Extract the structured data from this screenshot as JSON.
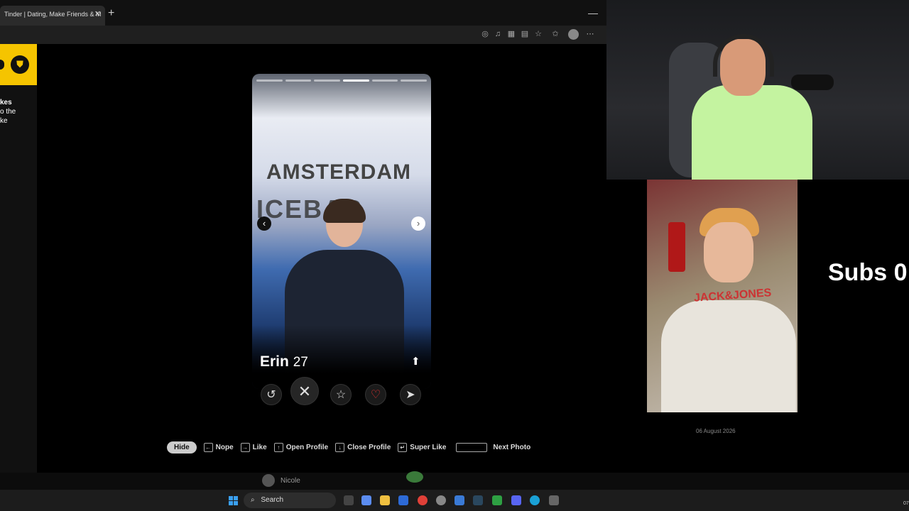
{
  "browser": {
    "tab_title": "Tinder | Dating, Make Friends & M",
    "tab_close": "✕",
    "new_tab": "+",
    "minimize": "—"
  },
  "left_panel": {
    "line1": "kes",
    "line2": "o the",
    "line3": "ke"
  },
  "card": {
    "name": "Erin",
    "age": "27",
    "photo_count": 6,
    "active_photo": 4,
    "sign_line1": "AMSTERDAM",
    "sign_line2": "ICEBAR"
  },
  "shortcuts": {
    "hide": "Hide",
    "nope": "Nope",
    "like": "Like",
    "open_profile": "Open Profile",
    "close_profile": "Close Profile",
    "super_like": "Super Like",
    "next_photo": "Next Photo"
  },
  "overlay": {
    "subs": "Subs 0",
    "date": "06 August 2026",
    "nicole": "Nicole"
  },
  "taskbar": {
    "search": "Search",
    "clock": "07"
  },
  "colors": {
    "shield_yellow": "#f5c400",
    "like_red": "#e33333"
  }
}
